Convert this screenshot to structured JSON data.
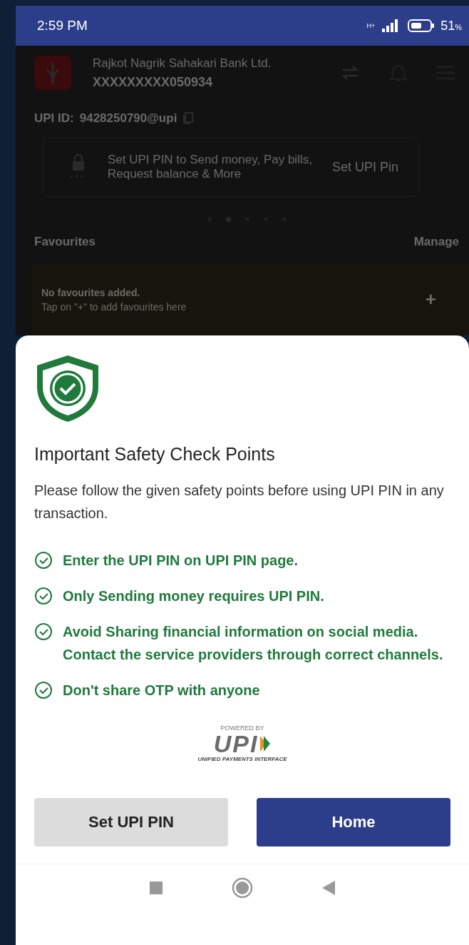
{
  "status_bar": {
    "time": "2:59 PM",
    "network": "H+",
    "battery": "51",
    "battery_unit": "%"
  },
  "header": {
    "bank_name": "Rajkot Nagrik Sahakari Bank Ltd.",
    "account": "XXXXXXXXX050934",
    "upi_label": "UPI ID:",
    "upi_id": "9428250790@upi"
  },
  "banner": {
    "message": "Set UPI PIN to Send money, Pay bills, Request balance & More",
    "action": "Set UPI Pin"
  },
  "carousel_dots": [
    {
      "selected": false
    },
    {
      "selected": true
    },
    {
      "selected": false
    },
    {
      "selected": false
    },
    {
      "selected": false
    }
  ],
  "favourites": {
    "title": "Favourites",
    "manage": "Manage",
    "empty_title": "No favourites added.",
    "empty_hint": "Tap on \"+\" to add favourites here",
    "add": "+"
  },
  "sheet": {
    "title": "Important Safety Check Points",
    "intro": "Please follow the given safety points before using UPI PIN in any transaction.",
    "points": [
      "Enter the UPI PIN on UPI PIN page.",
      "Only Sending money requires UPI PIN.",
      "Avoid Sharing financial information on social media. Contact the service providers through correct channels.",
      "Don't share OTP with anyone"
    ],
    "powered_by": "POWERED BY",
    "upi_logo": "UPI",
    "upi_tagline": "UNIFIED PAYMENTS INTERFACE",
    "buttons": [
      {
        "label": "Set UPI PIN",
        "kind": "secondary"
      },
      {
        "label": "Home",
        "kind": "primary"
      }
    ]
  }
}
